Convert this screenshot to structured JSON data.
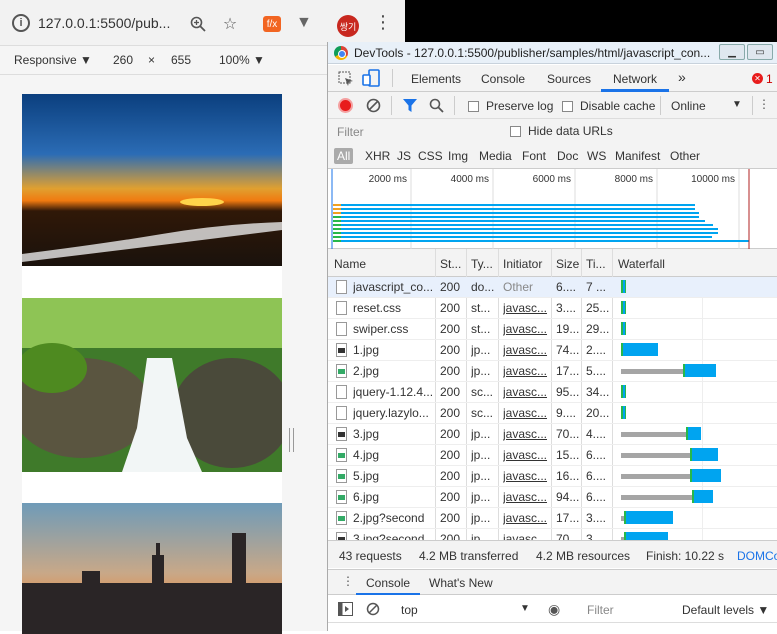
{
  "browser": {
    "url": "127.0.0.1:5500/pub...",
    "extension_fx_label": "f/x",
    "profile_label": "쌍기",
    "device_toolbar": {
      "mode": "Responsive ▼",
      "width": "260",
      "times": "×",
      "height": "655",
      "zoom": "100% ▼"
    }
  },
  "devtools": {
    "window_title": "DevTools - 127.0.0.1:5500/publisher/samples/html/javascript_con...",
    "tabs": [
      "Elements",
      "Console",
      "Sources",
      "Network"
    ],
    "more_tabs": "»",
    "error_count": "1",
    "toolbar": {
      "preserve_log": "Preserve log",
      "disable_cache": "Disable cache",
      "throttle": "Online"
    },
    "filter_placeholder": "Filter",
    "hide_data_urls": "Hide data URLs",
    "types": [
      "All",
      "XHR",
      "JS",
      "CSS",
      "Img",
      "Media",
      "Font",
      "Doc",
      "WS",
      "Manifest",
      "Other"
    ],
    "timeline_ticks": [
      "2000 ms",
      "4000 ms",
      "6000 ms",
      "8000 ms",
      "10000 ms"
    ],
    "columns": [
      "Name",
      "St...",
      "Ty...",
      "Initiator",
      "Size",
      "Ti...",
      "Waterfall"
    ],
    "requests": [
      {
        "name": "javascript_co...",
        "status": "200",
        "type": "do...",
        "initiator": "Other",
        "size": "6....",
        "time": "7 ...",
        "icon": "doc",
        "wait": 0,
        "recv": 0.01
      },
      {
        "name": "reset.css",
        "status": "200",
        "type": "st...",
        "initiator": "javasc...",
        "size": "3....",
        "time": "25...",
        "icon": "doc",
        "wait": 0,
        "recv": 0.01
      },
      {
        "name": "swiper.css",
        "status": "200",
        "type": "st...",
        "initiator": "javasc...",
        "size": "19...",
        "time": "29...",
        "icon": "doc",
        "wait": 0,
        "recv": 0.01
      },
      {
        "name": "1.jpg",
        "status": "200",
        "type": "jp...",
        "initiator": "javasc...",
        "size": "74...",
        "time": "2....",
        "icon": "img-dark",
        "wait": 0,
        "recv": 0.23
      },
      {
        "name": "2.jpg",
        "status": "200",
        "type": "jp...",
        "initiator": "javasc...",
        "size": "17...",
        "time": "5....",
        "icon": "img",
        "wait": 0.41,
        "recv": 0.21
      },
      {
        "name": "jquery-1.12.4...",
        "status": "200",
        "type": "sc...",
        "initiator": "javasc...",
        "size": "95...",
        "time": "34...",
        "icon": "doc",
        "wait": 0,
        "recv": 0.01
      },
      {
        "name": "jquery.lazylo...",
        "status": "200",
        "type": "sc...",
        "initiator": "javasc...",
        "size": "9....",
        "time": "20...",
        "icon": "doc",
        "wait": 0,
        "recv": 0.01
      },
      {
        "name": "3.jpg",
        "status": "200",
        "type": "jp...",
        "initiator": "javasc...",
        "size": "70...",
        "time": "4....",
        "icon": "img-dark",
        "wait": 0.43,
        "recv": 0.09
      },
      {
        "name": "4.jpg",
        "status": "200",
        "type": "jp...",
        "initiator": "javasc...",
        "size": "15...",
        "time": "6....",
        "icon": "img",
        "wait": 0.46,
        "recv": 0.17
      },
      {
        "name": "5.jpg",
        "status": "200",
        "type": "jp...",
        "initiator": "javasc...",
        "size": "16...",
        "time": "6....",
        "icon": "img",
        "wait": 0.46,
        "recv": 0.19
      },
      {
        "name": "6.jpg",
        "status": "200",
        "type": "jp...",
        "initiator": "javasc...",
        "size": "94...",
        "time": "6....",
        "icon": "img",
        "wait": 0.47,
        "recv": 0.13
      },
      {
        "name": "2.jpg?second",
        "status": "200",
        "type": "jp...",
        "initiator": "javasc...",
        "size": "17...",
        "time": "3....",
        "icon": "img",
        "wait": 0.02,
        "recv": 0.31
      },
      {
        "name": "3.jpg?second",
        "status": "200",
        "type": "jp...",
        "initiator": "javasc...",
        "size": "70...",
        "time": "3....",
        "icon": "img-dark",
        "wait": 0.02,
        "recv": 0.28
      }
    ],
    "summary": {
      "requests": "43 requests",
      "transferred": "4.2 MB transferred",
      "resources": "4.2 MB resources",
      "finish": "Finish: 10.22 s",
      "domc": "DOMCo"
    },
    "drawer_tabs": [
      "Console",
      "What's New"
    ],
    "console_context": "top",
    "console_filter": "Filter",
    "log_levels": "Default levels ▼"
  },
  "colors": {
    "accent": "#1a73e8",
    "receive": "#00a4f0",
    "wait": "#a5a5a5",
    "connect": "#27b84a",
    "record": "#e81c1c"
  }
}
